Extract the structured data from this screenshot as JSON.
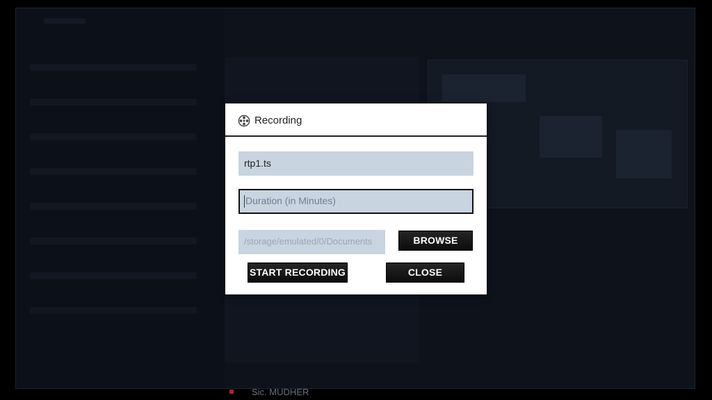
{
  "background": {
    "bottom_list_item": "Sic. MUDHER"
  },
  "dialog": {
    "title": "Recording",
    "icon": "film-reel-icon",
    "filename_value": "rtp1.ts",
    "duration_placeholder": "Duration (in Minutes)",
    "path_value": "/storage/emulated/0/Documents",
    "browse_label": "BROWSE",
    "start_label": "START RECORDING",
    "close_label": "CLOSE"
  },
  "colors": {
    "field_bg": "#c8d4e0",
    "button_bg": "#111111",
    "accent_marker": "#c21a3a"
  }
}
